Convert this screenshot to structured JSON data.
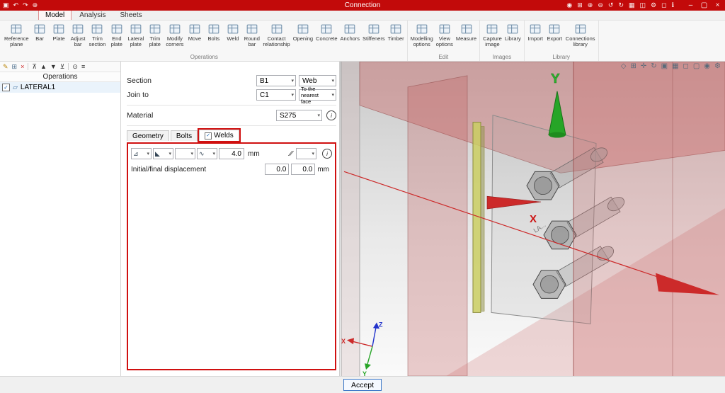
{
  "colors": {
    "titlebar_red": "#c20a0a",
    "annotation_red": "#d01010",
    "accent_blue": "#3c78c8",
    "axis_x_red": "#cc2a2a",
    "axis_y_green": "#27a527",
    "axis_z_blue": "#2233cc",
    "member_pink": "#c86060",
    "highlight_yellow": "#c8cc60"
  },
  "ui": {
    "check_glyph": "✓",
    "caret_glyph": "▾",
    "info_glyph": "i",
    "operation_glyph": "▱"
  },
  "titlebar": {
    "title": "Connection",
    "left_icons": [
      {
        "name": "save-icon",
        "glyph": "▣"
      },
      {
        "name": "undo-icon",
        "glyph": "↶"
      },
      {
        "name": "redo-icon",
        "glyph": "↷"
      },
      {
        "name": "zoom-icon",
        "glyph": "⊕"
      }
    ],
    "right_icons": [
      {
        "name": "user-icon",
        "glyph": "◉"
      },
      {
        "name": "zoom-window-icon",
        "glyph": "⊞"
      },
      {
        "name": "zoom-in-icon",
        "glyph": "⊕"
      },
      {
        "name": "zoom-out-icon",
        "glyph": "⊖"
      },
      {
        "name": "rotate-left-icon",
        "glyph": "↺"
      },
      {
        "name": "rotate-right-icon",
        "glyph": "↻"
      },
      {
        "name": "grid-icon",
        "glyph": "▦"
      },
      {
        "name": "layout-icon",
        "glyph": "◫"
      },
      {
        "name": "settings-icon",
        "glyph": "⚙"
      },
      {
        "name": "screen-icon",
        "glyph": "◻"
      },
      {
        "name": "help-icon",
        "glyph": "ℹ"
      }
    ],
    "window_controls": [
      {
        "name": "minimize-button",
        "glyph": "–"
      },
      {
        "name": "maximize-button",
        "glyph": "▢"
      },
      {
        "name": "close-button",
        "glyph": "×"
      }
    ]
  },
  "ribbon": {
    "tabs": [
      {
        "label": "Model",
        "active": true
      },
      {
        "label": "Analysis",
        "active": false
      },
      {
        "label": "Sheets",
        "active": false
      }
    ],
    "groups": [
      {
        "label": "Operations",
        "items": [
          "Reference plane",
          "Bar",
          "Plate",
          "Adjust bar",
          "Trim section",
          "End plate",
          "Lateral plate",
          "Trim plate",
          "Modify corners",
          "Move",
          "Bolts",
          "Weld",
          "Round bar",
          "Contact relationship",
          "Opening",
          "Concrete",
          "Anchors",
          "Stiffeners",
          "Timber"
        ]
      },
      {
        "label": "Edit",
        "items": [
          "Modelling options",
          "View options",
          "Measure"
        ]
      },
      {
        "label": "Images",
        "items": [
          "Capture image",
          "Library"
        ]
      },
      {
        "label": "Library",
        "items": [
          "Import",
          "Export",
          "Connections library"
        ]
      }
    ]
  },
  "operations_panel": {
    "header": "Operations",
    "toolbar": [
      {
        "name": "edit-icon",
        "glyph": "✎",
        "color": "#b8860b"
      },
      {
        "name": "copy-icon",
        "glyph": "⊞",
        "color": "#4a6d8c"
      },
      {
        "name": "delete-icon",
        "glyph": "×",
        "color": "#cc2222"
      },
      {
        "name": "separator"
      },
      {
        "name": "move-top-icon",
        "glyph": "⊼",
        "color": "#333333"
      },
      {
        "name": "move-up-icon",
        "glyph": "▲",
        "color": "#333333"
      },
      {
        "name": "move-down-icon",
        "glyph": "▼",
        "color": "#333333"
      },
      {
        "name": "move-bottom-icon",
        "glyph": "⊻",
        "color": "#333333"
      },
      {
        "name": "separator"
      },
      {
        "name": "search-icon",
        "glyph": "⊙",
        "color": "#333333"
      },
      {
        "name": "filter-icon",
        "glyph": "≡",
        "color": "#333333"
      }
    ],
    "items": [
      {
        "label": "LATERAL1",
        "checked": true,
        "selected": true
      }
    ]
  },
  "properties": {
    "section": {
      "label": "Section",
      "value": "B1",
      "part": "Web"
    },
    "join_to": {
      "label": "Join to",
      "value": "C1",
      "face": "To the nearest face"
    },
    "material": {
      "label": "Material",
      "value": "S275"
    },
    "tabs": [
      {
        "label": "Geometry",
        "active": false,
        "checkbox": false
      },
      {
        "label": "Bolts",
        "active": false,
        "checkbox": false
      },
      {
        "label": "Welds",
        "active": true,
        "checkbox": true
      }
    ],
    "weld_controls": [
      {
        "name": "weld-type-select",
        "glyph": "⊿"
      },
      {
        "name": "weld-side-select",
        "glyph": "◣"
      },
      {
        "name": "weld-material-select",
        "glyph": ""
      },
      {
        "name": "weld-shape-select",
        "glyph": "∿"
      }
    ],
    "weld": {
      "throat_value": "4.0",
      "throat_unit": "mm",
      "continuity_glyph": "∕∕",
      "displacement_label": "Initial/final displacement",
      "displacement_start": "0.0",
      "displacement_end": "0.0",
      "displacement_unit": "mm"
    }
  },
  "viewport": {
    "toolbar": [
      {
        "name": "perspective-icon",
        "glyph": "◇"
      },
      {
        "name": "zoom-fit-icon",
        "glyph": "⊞"
      },
      {
        "name": "pan-icon",
        "glyph": "✛"
      },
      {
        "name": "rotate-view-icon",
        "glyph": "↻"
      },
      {
        "name": "front-view-icon",
        "glyph": "▣"
      },
      {
        "name": "solid-view-icon",
        "glyph": "▦"
      },
      {
        "name": "transparent-view-icon",
        "glyph": "◻"
      },
      {
        "name": "wireframe-view-icon",
        "glyph": "▢"
      },
      {
        "name": "visibility-icon",
        "glyph": "◉"
      },
      {
        "name": "view-settings-icon",
        "glyph": "⚙"
      }
    ],
    "axes": {
      "x": "X",
      "y": "Y",
      "z": "Z"
    },
    "part_label": "LA..."
  },
  "footer": {
    "accept_label": "Accept"
  }
}
